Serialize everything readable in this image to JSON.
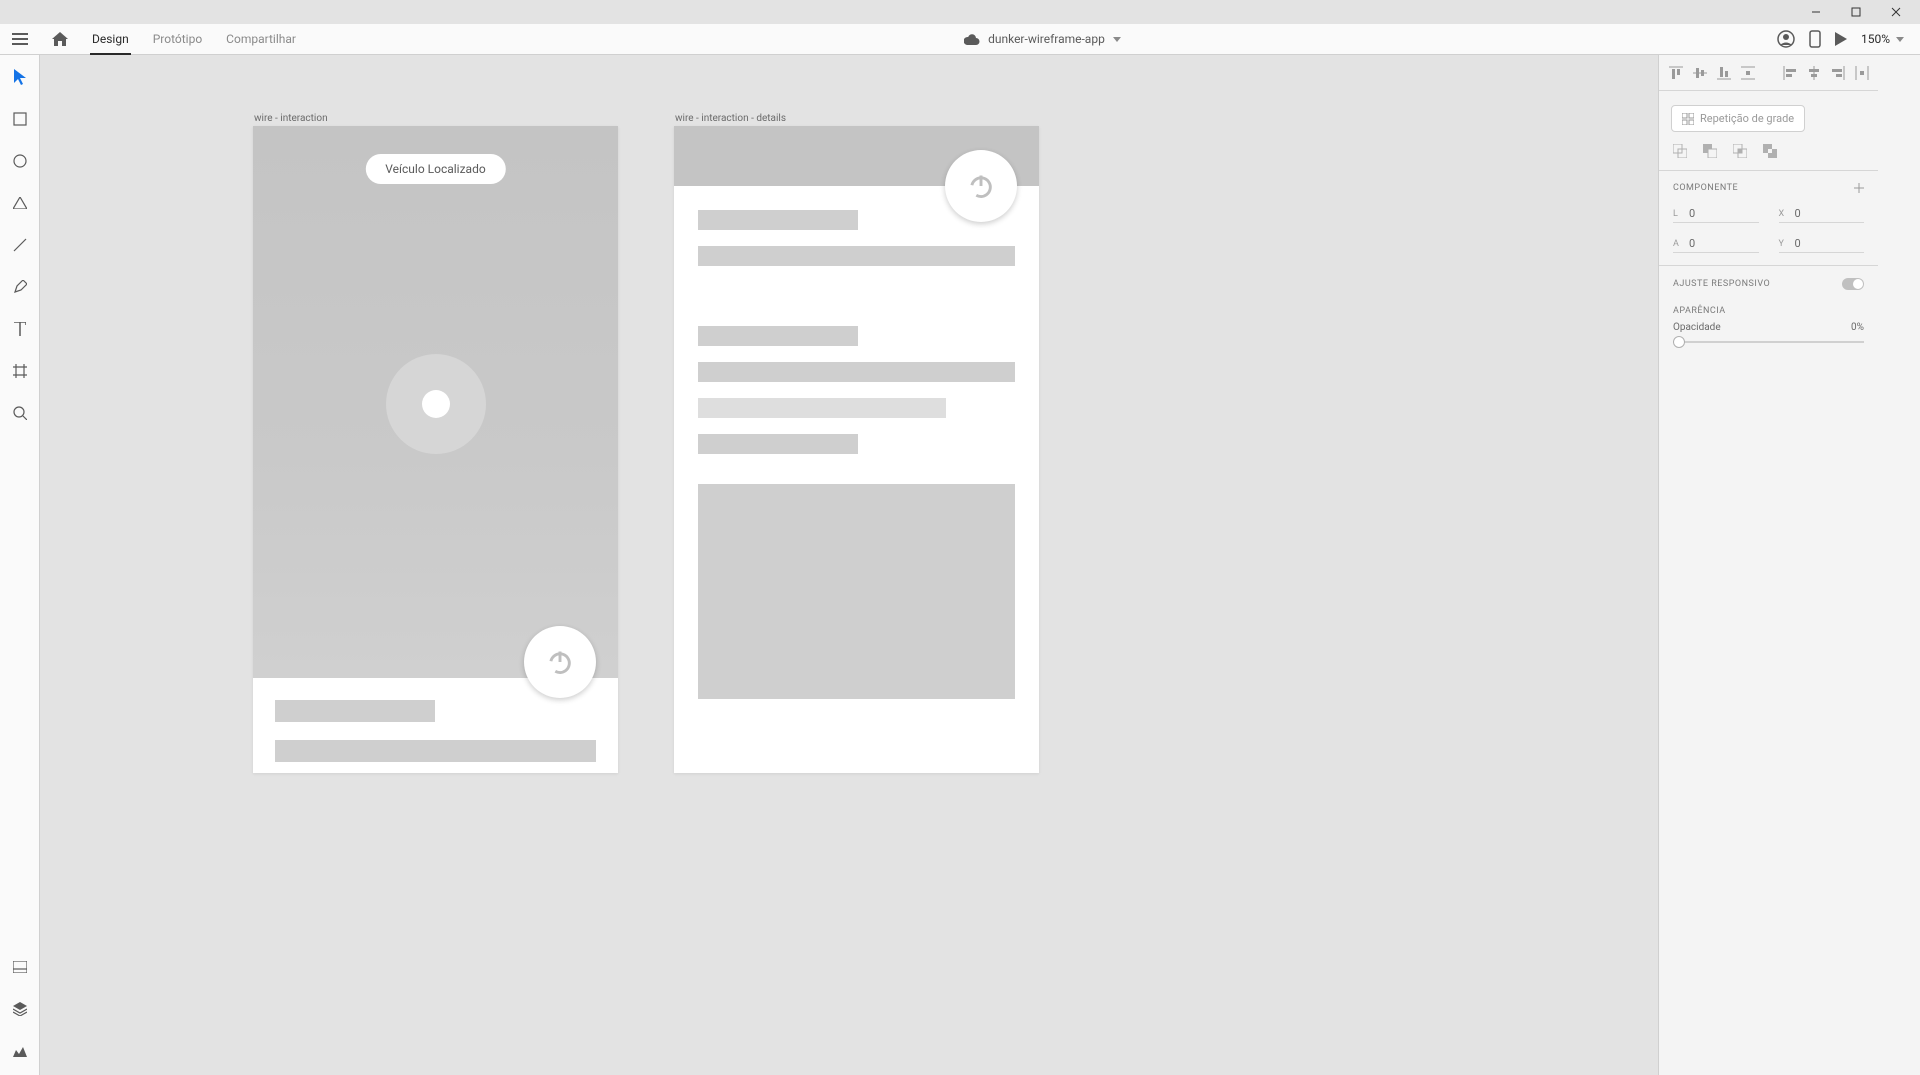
{
  "window": {
    "minimize": "–",
    "maximize": "▭",
    "close": "✕"
  },
  "header": {
    "tabs": {
      "design": "Design",
      "prototype": "Protótipo",
      "share": "Compartilhar"
    },
    "doc_title": "dunker-wireframe-app",
    "zoom": "150%"
  },
  "canvas": {
    "artboard1": {
      "label": "wire - interaction",
      "pill": "Veículo Localizado"
    },
    "artboard2": {
      "label": "wire - interaction - details"
    }
  },
  "right": {
    "repeat_grid": "Repetição de grade",
    "component_title": "COMPONENTE",
    "transform": {
      "l_label": "L",
      "l_value": "0",
      "x_label": "X",
      "x_value": "0",
      "a_label": "A",
      "a_value": "0",
      "y_label": "Y",
      "y_value": "0"
    },
    "responsive_title": "AJUSTE RESPONSIVO",
    "appearance_title": "APARÊNCIA",
    "opacity_label": "Opacidade",
    "opacity_value": "0%"
  }
}
